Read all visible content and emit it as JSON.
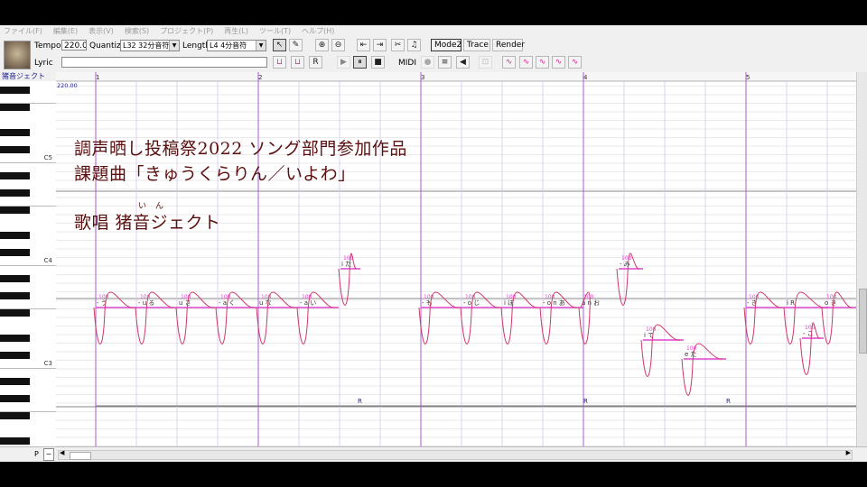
{
  "menu": [
    "ファイル(F)",
    "編集(E)",
    "表示(V)",
    "検索(S)",
    "プロジェクト(P)",
    "再生(L)",
    "ツール(T)",
    "ヘルプ(H)"
  ],
  "toolbar": {
    "tempo_label": "Tempo",
    "tempo_value": "220.0",
    "quantize_label": "Quantize",
    "quantize_value": "L32 32分音符",
    "length_label": "Length",
    "length_value": "L4  4分音符",
    "lyric_label": "Lyric",
    "lyric_value": "",
    "mode2_label": "Mode2",
    "trace_label": "Trace",
    "render_label": "Render",
    "midi_label": "MIDI"
  },
  "icons": {
    "arrow": "↖",
    "pencil": "✎",
    "zoomin": "⊕",
    "zoomout": "⊖",
    "prev": "⇤",
    "next": "⇥",
    "split": "✂",
    "join": "♫",
    "play": "▶",
    "pause": "⏸",
    "stop": "■",
    "rec": "●",
    "mixer": "≡",
    "speaker": "◀",
    "r": "R"
  },
  "singer_name": "猪音ジェクト",
  "tempo_marker": "220.00",
  "measures": [
    "1",
    "2",
    "3",
    "4",
    "5"
  ],
  "octaves": [
    "C5",
    "C4",
    "C3"
  ],
  "overlay": {
    "line1": "調声晒し投稿祭2022 ソング部門参加作品",
    "line2": "課題曲「きゅうくらりん／いよわ」",
    "line3": "歌唱 猪音ジェクト",
    "ruby1": "い",
    "ruby2": "ん"
  },
  "notes": [
    {
      "lyric": "- う",
      "vel": "100"
    },
    {
      "lyric": "- u る",
      "vel": "100"
    },
    {
      "lyric": "u さ",
      "vel": "100"
    },
    {
      "lyric": "- a く",
      "vel": "100"
    },
    {
      "lyric": "u な",
      "vel": "100"
    },
    {
      "lyric": "- a い",
      "vel": "100"
    },
    {
      "lyric": "i た",
      "vel": "100"
    },
    {
      "lyric": "- も",
      "vel": "100"
    },
    {
      "lyric": "- o じ",
      "vel": "100"
    },
    {
      "lyric": "i ぼ",
      "vel": "100"
    },
    {
      "lyric": "- o n あ",
      "vel": "100"
    },
    {
      "lyric": "a n お",
      "vel": "100"
    },
    {
      "lyric": "- み",
      "vel": "100"
    },
    {
      "lyric": "i て",
      "vel": "100"
    },
    {
      "lyric": "e た",
      "vel": "100"
    },
    {
      "lyric": "- き",
      "vel": "100"
    },
    {
      "lyric": "i R",
      "vel": ""
    },
    {
      "lyric": "o き",
      "vel": "100"
    },
    {
      "lyric": "- こ",
      "vel": "100"
    }
  ],
  "rests": [
    "R",
    "R",
    "R"
  ],
  "bottom": {
    "p_label": "P",
    "p_value": "~"
  },
  "colors": {
    "pitch": "#d0396a",
    "note": "#e044d0",
    "bar_line": "#b06ad8",
    "beat_line": "#d7c5f0"
  }
}
